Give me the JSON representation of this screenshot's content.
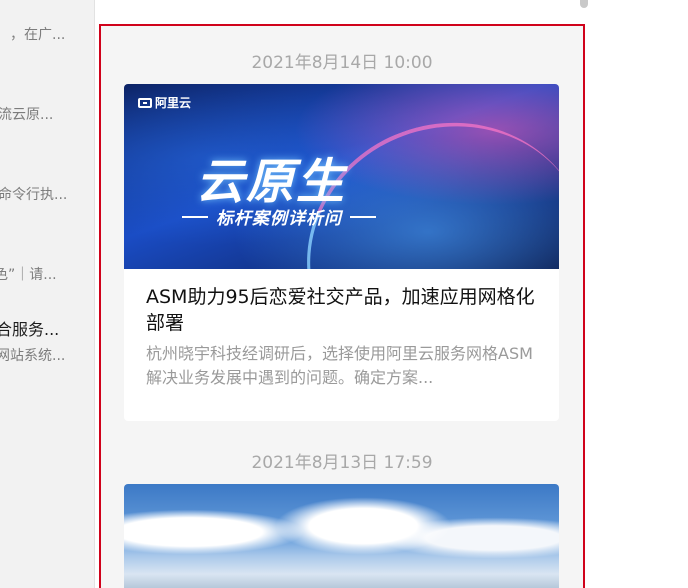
{
  "left_list": {
    "snippets": [
      "，在广...",
      "流云原...",
      "命令行执...",
      "色”｜请...",
      "合服务...",
      "网站系统..."
    ]
  },
  "feed": {
    "items": [
      {
        "time": "2021年8月14日 10:00",
        "banner": {
          "logo": "阿里云",
          "title": "云原生",
          "subtitle": "标杆案例详析问"
        },
        "title": "ASM助力95后恋爱社交产品，加速应用网格化部署",
        "description": "杭州晓宇科技经调研后，选择使用阿里云服务网格ASM解决业务发展中遇到的问题。确定方案..."
      },
      {
        "time": "2021年8月13日 17:59",
        "image": "snowy-mountain-photo"
      }
    ]
  },
  "colors": {
    "highlight_border": "#d0021b",
    "feed_background": "#f5f5f5",
    "timestamp": "#a8a8a8"
  }
}
